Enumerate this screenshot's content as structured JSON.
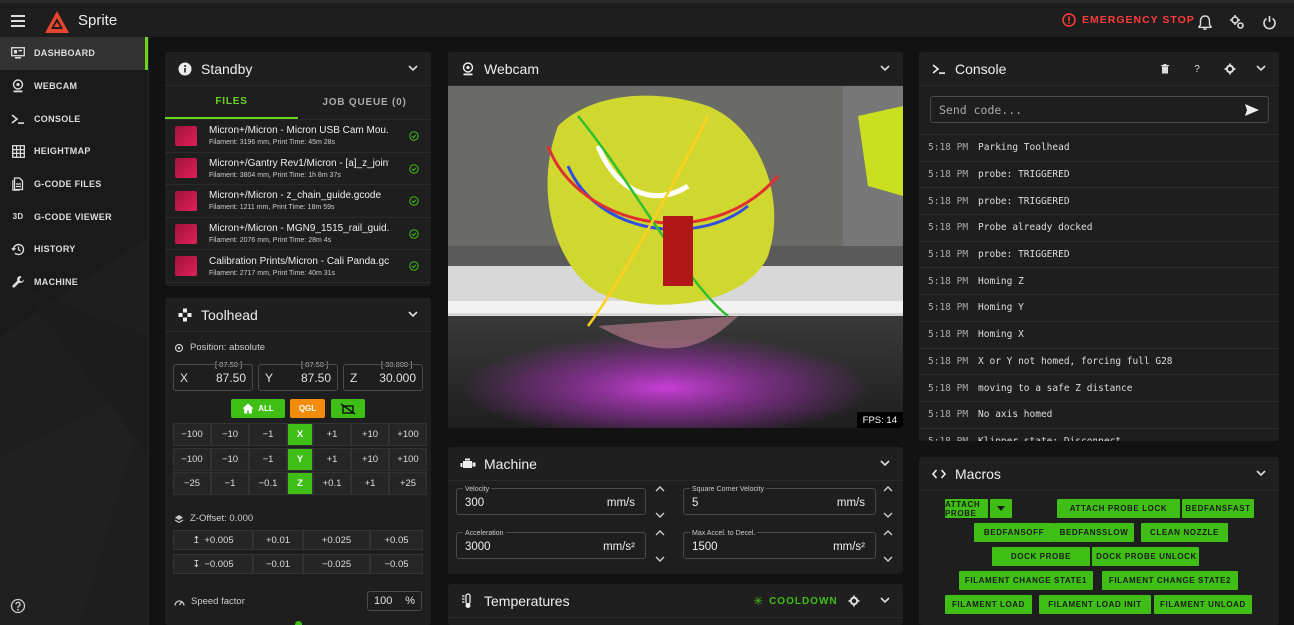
{
  "app": {
    "title": "Sprite"
  },
  "topbar": {
    "emergency_stop": "EMERGENCY STOP"
  },
  "sidebar": {
    "items": [
      {
        "label": "DASHBOARD",
        "icon": "dashboard-icon",
        "active": true
      },
      {
        "label": "WEBCAM",
        "icon": "webcam-icon"
      },
      {
        "label": "CONSOLE",
        "icon": "console-icon"
      },
      {
        "label": "HEIGHTMAP",
        "icon": "grid-icon"
      },
      {
        "label": "G-CODE FILES",
        "icon": "files-icon"
      },
      {
        "label": "G-CODE VIEWER",
        "icon": "3d-icon"
      },
      {
        "label": "HISTORY",
        "icon": "history-icon"
      },
      {
        "label": "MACHINE",
        "icon": "wrench-icon"
      }
    ],
    "icon_3d_text": "3D"
  },
  "standby": {
    "title": "Standby",
    "tabs": [
      "FILES",
      "JOB QUEUE (0)"
    ],
    "files": [
      {
        "name": "Micron+/Micron - Micron USB Cam Mou...",
        "meta": "Filament: 3196 mm, Print Time: 45m 28s"
      },
      {
        "name": "Micron+/Gantry Rev1/Micron - [a]_z_joint...",
        "meta": "Filament: 3804 mm, Print Time: 1h 8m 37s"
      },
      {
        "name": "Micron+/Micron - z_chain_guide.gcode",
        "meta": "Filament: 1211 mm, Print Time: 18m 59s"
      },
      {
        "name": "Micron+/Micron - MGN9_1515_rail_guid...",
        "meta": "Filament: 2076 mm, Print Time: 28m 4s"
      },
      {
        "name": "Calibration Prints/Micron - Cali Panda.gc...",
        "meta": "Filament: 2717 mm, Print Time: 40m 31s"
      }
    ]
  },
  "toolhead": {
    "title": "Toolhead",
    "position_label": "Position: absolute",
    "axes": [
      {
        "label": "X",
        "value": "87.50",
        "hint": "[ 87.50 ]"
      },
      {
        "label": "Y",
        "value": "87.50",
        "hint": "[ 87.50 ]"
      },
      {
        "label": "Z",
        "value": "30.000",
        "hint": "[ 30.000 ]"
      }
    ],
    "home_all": "ALL",
    "qgl": "QGL",
    "jog_rows": [
      {
        "neg": [
          "−100",
          "−10",
          "−1"
        ],
        "axis": "X",
        "pos": [
          "+1",
          "+10",
          "+100"
        ]
      },
      {
        "neg": [
          "−100",
          "−10",
          "−1"
        ],
        "axis": "Y",
        "pos": [
          "+1",
          "+10",
          "+100"
        ]
      },
      {
        "neg": [
          "−25",
          "−1",
          "−0.1"
        ],
        "axis": "Z",
        "pos": [
          "+0.1",
          "+1",
          "+25"
        ]
      }
    ],
    "zoffset_label": "Z-Offset: 0.000",
    "zoffset_up": [
      "+0.005",
      "+0.01",
      "+0.025",
      "+0.05"
    ],
    "zoffset_down": [
      "−0.005",
      "−0.01",
      "−0.025",
      "−0.05"
    ],
    "speed_label": "Speed factor",
    "speed_value": "100",
    "speed_unit": "%"
  },
  "webcam": {
    "title": "Webcam",
    "fps": "FPS: 14"
  },
  "machine": {
    "title": "Machine",
    "fields": [
      {
        "label": "Velocity",
        "value": "300",
        "unit": "mm/s"
      },
      {
        "label": "Square Corner Velocity",
        "value": "5",
        "unit": "mm/s"
      },
      {
        "label": "Acceleration",
        "value": "3000",
        "unit": "mm/s²"
      },
      {
        "label": "Max Accel. to Decel.",
        "value": "1500",
        "unit": "mm/s²"
      }
    ]
  },
  "temperatures": {
    "title": "Temperatures",
    "cooldown": "COOLDOWN"
  },
  "console": {
    "title": "Console",
    "placeholder": "Send code...",
    "logs": [
      {
        "time": "5:18 PM",
        "msg": "Parking Toolhead"
      },
      {
        "time": "5:18 PM",
        "msg": "probe: TRIGGERED"
      },
      {
        "time": "5:18 PM",
        "msg": "probe: TRIGGERED"
      },
      {
        "time": "5:18 PM",
        "msg": "Probe already docked"
      },
      {
        "time": "5:18 PM",
        "msg": "probe: TRIGGERED"
      },
      {
        "time": "5:18 PM",
        "msg": "Homing Z"
      },
      {
        "time": "5:18 PM",
        "msg": "Homing Y"
      },
      {
        "time": "5:18 PM",
        "msg": "Homing X"
      },
      {
        "time": "5:18 PM",
        "msg": "X or Y not homed, forcing full G28"
      },
      {
        "time": "5:18 PM",
        "msg": "moving to a safe Z distance"
      },
      {
        "time": "5:18 PM",
        "msg": "No axis homed"
      },
      {
        "time": "5:18 PM",
        "msg": "Klipper state: Disconnect"
      }
    ]
  },
  "macros": {
    "title": "Macros",
    "buttons": [
      "ATTACH PROBE",
      "ATTACH PROBE LOCK",
      "BEDFANSFAST",
      "BEDFANSOFF",
      "BEDFANSSLOW",
      "CLEAN NOZZLE",
      "DOCK PROBE",
      "DOCK PROBE UNLOCK",
      "FILAMENT CHANGE STATE1",
      "FILAMENT CHANGE STATE2",
      "FILAMENT LOAD",
      "FILAMENT LOAD INIT",
      "FILAMENT UNLOAD"
    ]
  },
  "colors": {
    "accent": "#3fbf16",
    "danger": "#ff3b3b",
    "warning": "#f28c0a"
  }
}
